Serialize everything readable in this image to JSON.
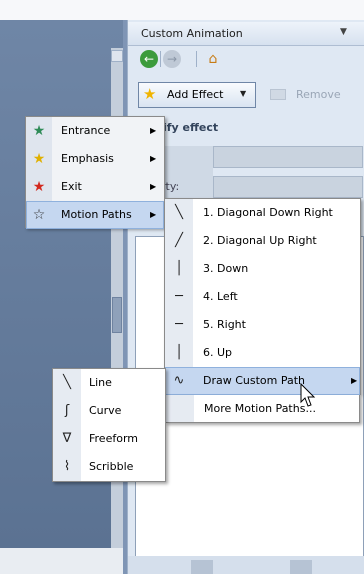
{
  "pane": {
    "title": "Custom Animation",
    "title_menu_glyph": "▼",
    "modify_label": "ify effect",
    "property_label": "rty:",
    "add_effect_label": "Add Effect",
    "add_effect_icon": "star-icon",
    "remove_label": "Remove",
    "nav_back_glyph": "←",
    "nav_forward_glyph": "→",
    "home_glyph": "⌂"
  },
  "menu1": {
    "items": [
      {
        "label": "Entrance",
        "icon": "green-star-icon",
        "glyph": "★",
        "color": "#2e8b57"
      },
      {
        "label": "Emphasis",
        "icon": "yellow-star-icon",
        "glyph": "★",
        "color": "#e0b000"
      },
      {
        "label": "Exit",
        "icon": "red-star-icon",
        "glyph": "★",
        "color": "#d2281e"
      },
      {
        "label": "Motion Paths",
        "icon": "outline-star-icon",
        "glyph": "☆",
        "color": "#333333"
      }
    ],
    "arrow_glyph": "▶"
  },
  "menu2": {
    "items": [
      {
        "label": "1. Diagonal Down Right",
        "icon": "diagonal-down-right-icon",
        "glyph": "╲"
      },
      {
        "label": "2. Diagonal Up Right",
        "icon": "diagonal-up-right-icon",
        "glyph": "╱"
      },
      {
        "label": "3. Down",
        "icon": "down-line-icon",
        "glyph": "│"
      },
      {
        "label": "4. Left",
        "icon": "left-line-icon",
        "glyph": "─"
      },
      {
        "label": "5. Right",
        "icon": "right-line-icon",
        "glyph": "─"
      },
      {
        "label": "6. Up",
        "icon": "up-line-icon",
        "glyph": "│"
      },
      {
        "label": "Draw Custom Path",
        "icon": "custom-path-icon",
        "glyph": "∿"
      },
      {
        "label": "More Motion Paths...",
        "icon": "",
        "glyph": ""
      }
    ]
  },
  "menu3": {
    "items": [
      {
        "label": "Line",
        "icon": "line-icon",
        "glyph": "╲"
      },
      {
        "label": "Curve",
        "icon": "curve-icon",
        "glyph": "ʃ"
      },
      {
        "label": "Freeform",
        "icon": "freeform-icon",
        "glyph": "∇"
      },
      {
        "label": "Scribble",
        "icon": "scribble-icon",
        "glyph": "⌇"
      }
    ]
  }
}
